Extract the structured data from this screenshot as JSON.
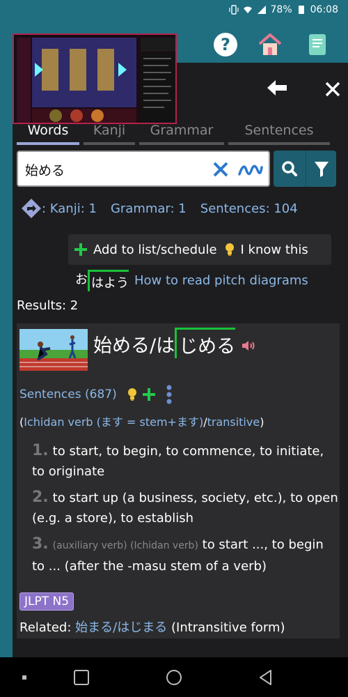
{
  "status": {
    "battery": "78%",
    "time": "06:08"
  },
  "tabs": [
    {
      "label": "Words",
      "active": true
    },
    {
      "label": "Kanji",
      "active": false
    },
    {
      "label": "Grammar",
      "active": false
    },
    {
      "label": "Sentences",
      "active": false
    }
  ],
  "search": {
    "value": "始める"
  },
  "counts": {
    "kanji": ": Kanji: 1",
    "grammar": "Grammar: 1",
    "sentences": "Sentences: 104"
  },
  "actions": {
    "add": "Add to list/schedule",
    "know": "I know this"
  },
  "pitch": {
    "low": "お",
    "high": "はよう",
    "link": "How to read pitch diagrams"
  },
  "results_label": "Results: 2",
  "entry": {
    "kanji_form": "始める/は",
    "high_part": "じめる",
    "sentences_link": "Sentences (687)",
    "pos_open": "(",
    "pos_link1": "Ichidan verb (ます = stem+ます)",
    "pos_sep": "/",
    "pos_link2": "transitive",
    "pos_close": ")",
    "definitions": [
      {
        "num": "1.",
        "tag": "",
        "text": "to start, to begin, to commence, to initiate, to originate"
      },
      {
        "num": "2.",
        "tag": "",
        "text": "to start up (a business, society, etc.), to open (e.g. a store), to establish"
      },
      {
        "num": "3.",
        "tag": "(auxiliary verb) (Ichidan verb)",
        "text": "to start ..., to begin to ... (after the -masu stem of a verb)"
      }
    ],
    "jlpt": "JLPT N5",
    "related_label": "Related:",
    "related_link": "始まる/はじまる",
    "related_note": "(Intransitive form)"
  },
  "colors": {
    "accent_teal": "#1f6f80",
    "link_blue": "#8cb8e8",
    "pitch_green": "#19c139",
    "jlpt_purple": "#8c72c8"
  }
}
